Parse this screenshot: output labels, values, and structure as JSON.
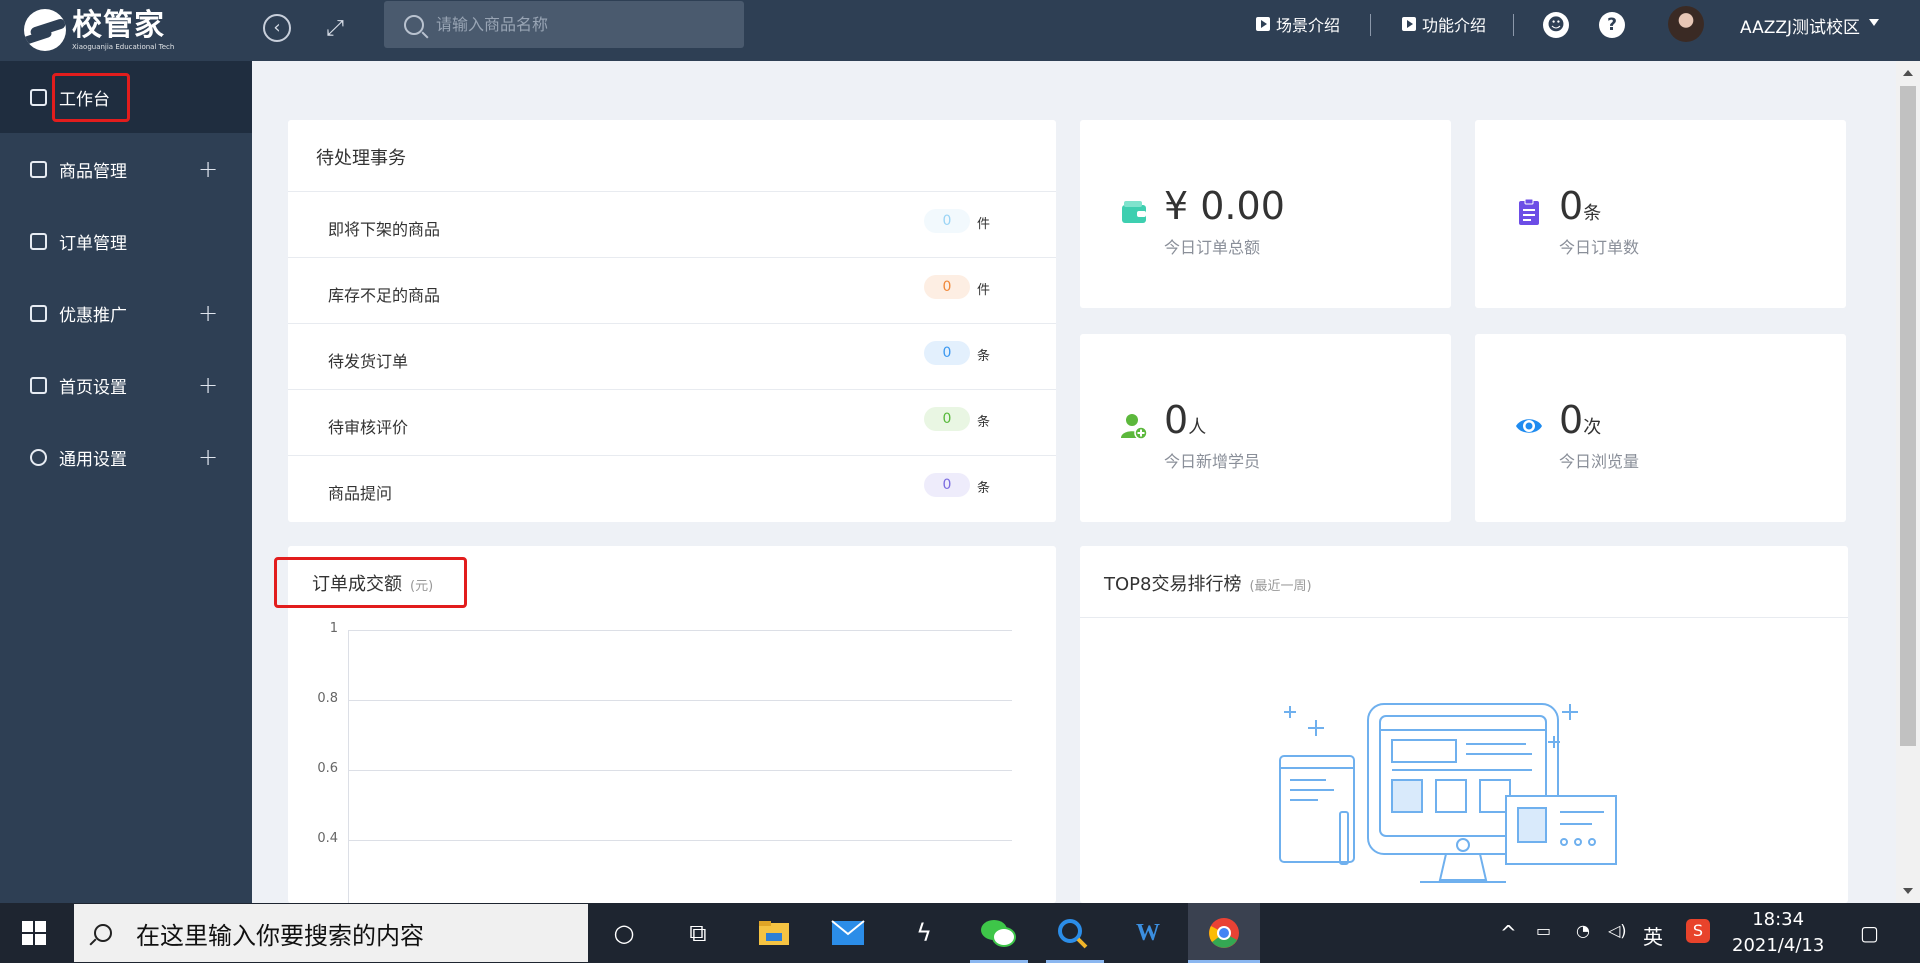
{
  "app": {
    "logo_name": "校管家",
    "logo_sub": "Xiaoguanjia Educational Tech"
  },
  "header": {
    "search_placeholder": "请输入商品名称",
    "scene_intro": "场景介绍",
    "feature_intro": "功能介绍",
    "help_label": "?",
    "user_name": "AAZZJ测试校区"
  },
  "sidebar": {
    "items": [
      {
        "label": "工作台",
        "icon": "monitor-icon",
        "expandable": false,
        "active": true
      },
      {
        "label": "商品管理",
        "icon": "bag-icon",
        "expandable": true
      },
      {
        "label": "订单管理",
        "icon": "document-icon",
        "expandable": false
      },
      {
        "label": "优惠推广",
        "icon": "coupon-icon",
        "expandable": true
      },
      {
        "label": "首页设置",
        "icon": "home-icon",
        "expandable": true
      },
      {
        "label": "通用设置",
        "icon": "gear-icon",
        "expandable": true
      }
    ],
    "plus": "+"
  },
  "pending": {
    "title": "待处理事务",
    "rows": [
      {
        "label": "即将下架的商品",
        "count": "0",
        "unit": "件",
        "color": "#9ad4f5",
        "bg": "#f2f9fd"
      },
      {
        "label": "库存不足的商品",
        "count": "0",
        "unit": "件",
        "color": "#f0883a",
        "bg": "#fdeee3"
      },
      {
        "label": "待发货订单",
        "count": "0",
        "unit": "条",
        "color": "#3b98f0",
        "bg": "#e3f0fd"
      },
      {
        "label": "待审核评价",
        "count": "0",
        "unit": "条",
        "color": "#57b93a",
        "bg": "#e9f6e3"
      },
      {
        "label": "商品提问",
        "count": "0",
        "unit": "条",
        "color": "#7a6be0",
        "bg": "#eeecfb"
      }
    ]
  },
  "stats": {
    "order_total": {
      "value": "¥ 0.00",
      "label": "今日订单总额",
      "icon": "wallet-icon",
      "color": "#3ecfb0"
    },
    "order_count": {
      "value": "0",
      "unit": "条",
      "label": "今日订单数",
      "icon": "clipboard-icon",
      "color": "#6c4de6"
    },
    "new_students": {
      "value": "0",
      "unit": "人",
      "label": "今日新增学员",
      "icon": "add-user-icon",
      "color": "#5cb83c"
    },
    "views": {
      "value": "0",
      "unit": "次",
      "label": "今日浏览量",
      "icon": "eye-icon",
      "color": "#1e8bf0"
    }
  },
  "order_chart": {
    "title": "订单成交额",
    "unit_note": "(元)"
  },
  "chart_data": {
    "type": "line",
    "title": "订单成交额",
    "ylabel": "(元)",
    "y_ticks": [
      "1",
      "0.8",
      "0.6",
      "0.4"
    ],
    "ylim": [
      0,
      1
    ],
    "series": [],
    "grid": true
  },
  "ranking": {
    "title": "TOP8交易排行榜",
    "note": "(最近一周)"
  },
  "taskbar": {
    "search_text": "在这里输入你要搜索的内容",
    "lang": "英",
    "time": "18:34",
    "date": "2021/4/13"
  }
}
